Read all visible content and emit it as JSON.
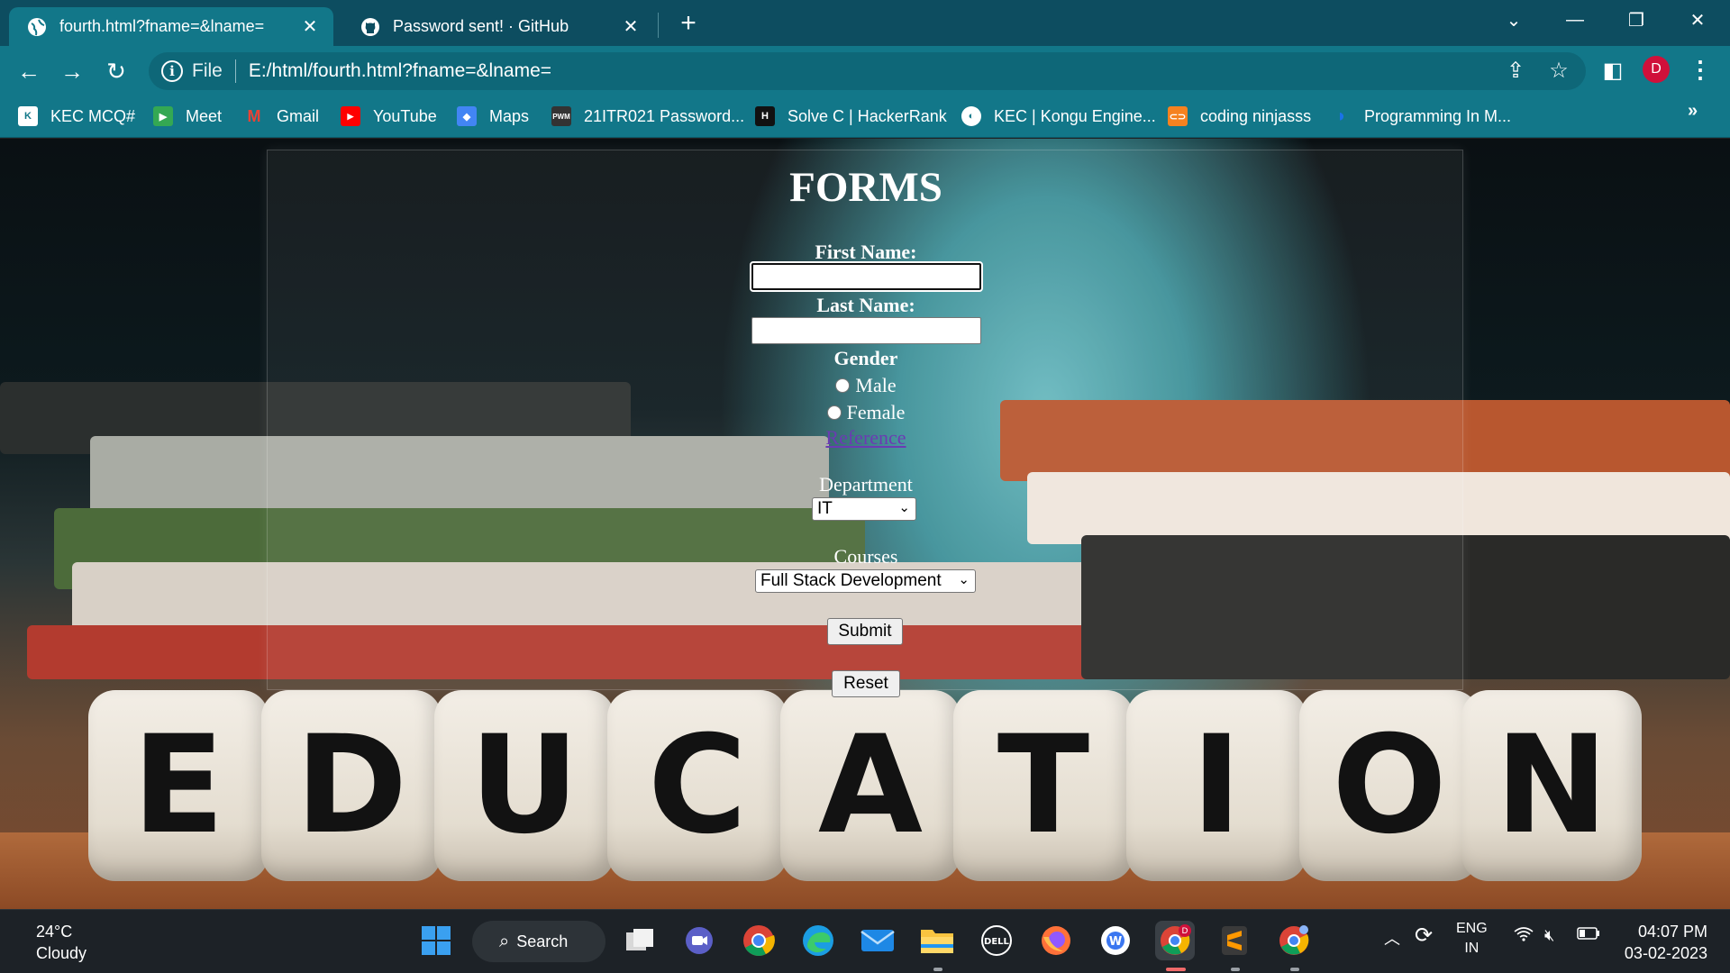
{
  "browser": {
    "tabs": [
      {
        "title": "fourth.html?fname=&lname=",
        "active": true,
        "icon": "globe-icon"
      },
      {
        "title": "Password sent! · GitHub",
        "active": false,
        "icon": "github-icon"
      }
    ],
    "address": {
      "scheme_label": "File",
      "url": "E:/html/fourth.html?fname=&lname="
    },
    "profile_initial": "D",
    "bookmarks": [
      {
        "label": "KEC MCQ#",
        "icon": "kec-icon",
        "color": "#ffffff"
      },
      {
        "label": "Meet",
        "icon": "meet-icon",
        "color": "#34a853"
      },
      {
        "label": "Gmail",
        "icon": "gmail-icon",
        "color": "#ea4335"
      },
      {
        "label": "YouTube",
        "icon": "youtube-icon",
        "color": "#ff0000"
      },
      {
        "label": "Maps",
        "icon": "maps-icon",
        "color": "#4285f4"
      },
      {
        "label": "21ITR021 Password...",
        "icon": "pwm-icon",
        "color": "#333333"
      },
      {
        "label": "Solve C | HackerRank",
        "icon": "hackerrank-icon",
        "color": "#111111"
      },
      {
        "label": "KEC | Kongu Engine...",
        "icon": "globe-icon",
        "color": "#ffffff"
      },
      {
        "label": "coding ninjasss",
        "icon": "codingninjas-icon",
        "color": "#f58220"
      },
      {
        "label": "Programming In M...",
        "icon": "programming-icon",
        "color": "#1a73e8"
      }
    ]
  },
  "form": {
    "title": "FORMS",
    "first_name_label": "First Name:",
    "first_name_value": "",
    "last_name_label": "Last Name:",
    "last_name_value": "",
    "gender_label": "Gender",
    "gender_options": [
      "Male",
      "Female"
    ],
    "reference_link": "Reference",
    "department_label": "Department",
    "department_value": "IT",
    "courses_label": "Courses",
    "courses_value": "Full Stack Development",
    "submit_label": "Submit",
    "reset_label": "Reset"
  },
  "background": {
    "dice_letters": [
      "E",
      "D",
      "U",
      "C",
      "A",
      "T",
      "I",
      "O",
      "N"
    ]
  },
  "taskbar": {
    "weather_temp": "24°C",
    "weather_desc": "Cloudy",
    "search_label": "Search",
    "language": "ENG",
    "region": "IN",
    "time": "04:07 PM",
    "date": "03-02-2023"
  },
  "colors": {
    "chrome_frame": "#0d4d60",
    "chrome_toolbar": "#127789",
    "taskbar": "#1d2227",
    "link": "#6b3bb3"
  }
}
